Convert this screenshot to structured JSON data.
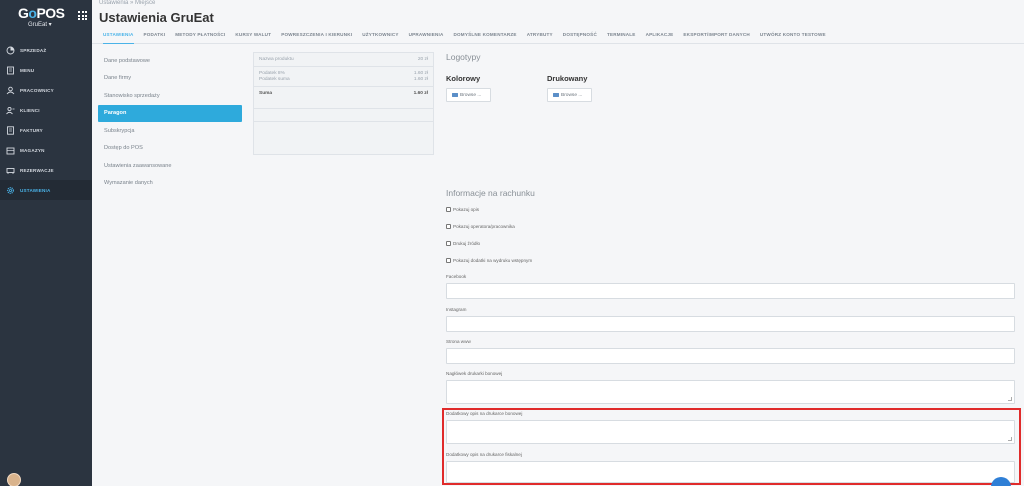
{
  "app": {
    "logo_text_1": "G",
    "logo_text_2": "POS",
    "company": "GruEat ▾",
    "colors": {
      "sidebar": "#2b3440",
      "accent": "#2eaadc",
      "highlight": "#e02b2b"
    }
  },
  "sidebar": {
    "items": [
      {
        "label": "SPRZEDAŻ",
        "icon": "sales-icon"
      },
      {
        "label": "MENU",
        "icon": "menu-icon"
      },
      {
        "label": "PRACOWNICY",
        "icon": "employees-icon"
      },
      {
        "label": "KLIENCI",
        "icon": "clients-icon"
      },
      {
        "label": "FAKTURY",
        "icon": "invoices-icon"
      },
      {
        "label": "MAGAZYN",
        "icon": "warehouse-icon"
      },
      {
        "label": "REZERWACJE",
        "icon": "reservations-icon"
      },
      {
        "label": "USTAWIENIA",
        "icon": "settings-icon"
      }
    ]
  },
  "header": {
    "breadcrumb": "Ustawienia  »  Miejsce",
    "title": "Ustawienia GruEat"
  },
  "tabs": [
    "USTAWIENIA",
    "PODATKI",
    "METODY PŁATNOŚCI",
    "KURSY WALUT",
    "POWRESZCZENIA I KIERUNKI",
    "UŻYTKOWNICY",
    "UPRAWNIENIA",
    "DOMYŚLNE KOMENTARZE",
    "ATRYBUTY",
    "DOSTĘPNOŚĆ",
    "TERMINALE",
    "APLIKACJE",
    "EKSPORT/IMPORT DANYCH",
    "UTWÓRZ KONTO TESTOWE"
  ],
  "submenu": [
    "Dane podstawowe",
    "Dane firmy",
    "Stanowisko sprzedaży",
    "Paragon",
    "Subskrypcja",
    "Dostęp do POS",
    "Ustawienia zaawansowane",
    "Wymazanie danych"
  ],
  "receipt": {
    "product_label": "Nazwa produktu",
    "product_value": "20 zł",
    "tax_label": "Podatek 8%",
    "tax_value": "1.60 zł",
    "tax_sum_label": "Podatek suma",
    "tax_sum_value": "1.60 zł",
    "sum_label": "Suma",
    "sum_value": "1.60 zł"
  },
  "logos": {
    "title": "Logotypy",
    "color_label": "Kolorowy",
    "print_label": "Drukowany",
    "browse": "Browse ..."
  },
  "invoice_info": {
    "title": "Informacje na rachunku",
    "checkboxes": [
      "Pokazuj opis",
      "Pokazuj operatora/pracownika",
      "Drukuj źródło",
      "Pokazuj dodatki na wydruku wstępnym"
    ],
    "fields": {
      "facebook": "Facebook",
      "instagram": "Instagram",
      "www": "Strona www",
      "header_bon": "Nagłówek drukarki bonowej",
      "extra_bon": "Dodatkowy opis na drukarce bonowej",
      "extra_fiscal": "Dodatkowy opis na drukarce fiskalnej"
    }
  }
}
